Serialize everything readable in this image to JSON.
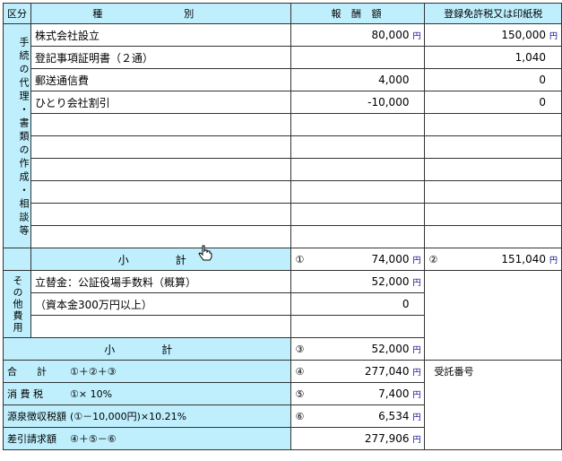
{
  "header": {
    "kubun": "区分",
    "shubetsu": "種　別",
    "hoshu": "報 酬 額",
    "tax": "登録免許税又は印紙税"
  },
  "section1_label": "手続の代理・書類の作成・相談等",
  "section2_label": "その他費用",
  "yen": "円",
  "items": [
    {
      "name": "株式会社設立",
      "fee": "80,000",
      "fee_yen": true,
      "tax": "150,000",
      "tax_yen": true
    },
    {
      "name": "登記事項証明書（２通）",
      "fee": "",
      "fee_yen": false,
      "tax": "1,040",
      "tax_yen": false
    },
    {
      "name": "郵送通信費",
      "fee": "4,000",
      "fee_yen": false,
      "tax": "0",
      "tax_yen": false
    },
    {
      "name": "ひとり会社割引",
      "fee": "-10,000",
      "fee_yen": false,
      "tax": "0",
      "tax_yen": false
    }
  ],
  "subtotal1": {
    "label": "小　計",
    "fee_mark": "①",
    "fee": "74,000",
    "tax_mark": "②",
    "tax": "151,040"
  },
  "other": [
    {
      "name": "立替金：公証役場手数料（概算）",
      "fee": "52,000",
      "yen": true
    },
    {
      "name": "（資本金300万円以上）",
      "fee": "0",
      "yen": false
    },
    {
      "name": "",
      "fee": "",
      "yen": false
    }
  ],
  "subtotal2": {
    "label": "小　計",
    "mark": "③",
    "fee": "52,000"
  },
  "summary": [
    {
      "label": "合　　計",
      "formula": "①＋②＋③",
      "mark": "④",
      "fee": "277,040"
    },
    {
      "label": "消 費 税",
      "formula": "①× 10%",
      "mark": "⑤",
      "fee": "7,400"
    },
    {
      "label": "源泉徴収税額",
      "formula": "(①－10,000円)×10.21%",
      "mark": "⑥",
      "fee": "6,534"
    },
    {
      "label": "差引請求額",
      "formula": "④＋⑤－⑥",
      "mark": "",
      "fee": "277,906"
    }
  ],
  "receipt_label": "受託番号",
  "colors": {
    "header_bg": "#bfeffd",
    "yen_color": "#00008b",
    "border": "#333333"
  },
  "cursor_icon": "hand-pointer-icon"
}
